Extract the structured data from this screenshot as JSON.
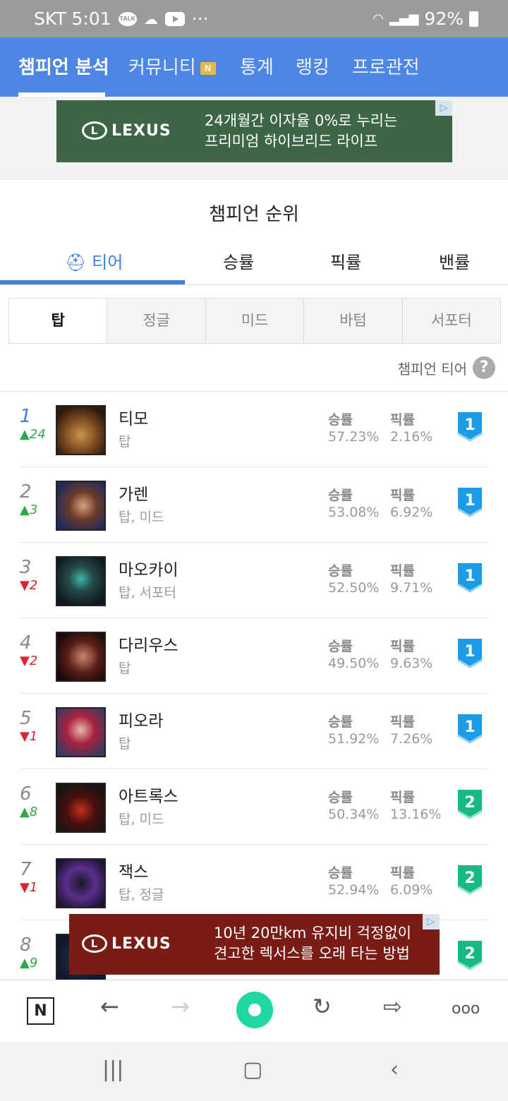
{
  "status_bar": {
    "carrier_time": "SKT 5:01",
    "talk_icon": "TALK",
    "more": "···",
    "battery": "92%"
  },
  "top_nav": {
    "tabs": [
      "챔피언 분석",
      "커뮤니티",
      "통계",
      "랭킹",
      "프로관전"
    ],
    "new_badge": "N"
  },
  "ad_top": {
    "brand": "LEXUS",
    "line1": "24개월간 이자율 0%로 누리는",
    "line2": "프리미엄 하이브리드 라이프"
  },
  "section": {
    "title": "챔피언 순위"
  },
  "rank_tabs": [
    "티어",
    "승률",
    "픽률",
    "밴률"
  ],
  "lanes": [
    "탑",
    "정글",
    "미드",
    "바텀",
    "서포터"
  ],
  "tier_label": "챔피언 티어",
  "help": "?",
  "labels": {
    "winrate": "승률",
    "pickrate": "픽률"
  },
  "champions": [
    {
      "rank": "1",
      "change": "▲24",
      "name": "티모",
      "positions": "탑",
      "winrate": "57.23%",
      "pickrate": "2.16%",
      "tier": "1"
    },
    {
      "rank": "2",
      "change": "▲3",
      "name": "가렌",
      "positions": "탑, 미드",
      "winrate": "53.08%",
      "pickrate": "6.92%",
      "tier": "1"
    },
    {
      "rank": "3",
      "change": "▼2",
      "name": "마오카이",
      "positions": "탑, 서포터",
      "winrate": "52.50%",
      "pickrate": "9.71%",
      "tier": "1"
    },
    {
      "rank": "4",
      "change": "▼2",
      "name": "다리우스",
      "positions": "탑",
      "winrate": "49.50%",
      "pickrate": "9.63%",
      "tier": "1"
    },
    {
      "rank": "5",
      "change": "▼1",
      "name": "피오라",
      "positions": "탑",
      "winrate": "51.92%",
      "pickrate": "7.26%",
      "tier": "1"
    },
    {
      "rank": "6",
      "change": "▲8",
      "name": "아트록스",
      "positions": "탑, 미드",
      "winrate": "50.34%",
      "pickrate": "13.16%",
      "tier": "2"
    },
    {
      "rank": "7",
      "change": "▼1",
      "name": "잭스",
      "positions": "탑, 정글",
      "winrate": "52.94%",
      "pickrate": "6.09%",
      "tier": "2"
    },
    {
      "rank": "8",
      "change": "▲9",
      "tier": "2"
    }
  ],
  "ad_bottom": {
    "brand": "LEXUS",
    "line1": "10년 20만km 유지비 걱정없이",
    "line2": "견고한 렉서스를 오래 타는 방법"
  },
  "browser_bar": {
    "home": "N",
    "back": "←",
    "forward": "→",
    "reload": "↻",
    "share": "⇨",
    "menu": "ooo"
  },
  "system_nav": {
    "recents": "|||",
    "home": "▢",
    "back": "‹"
  },
  "colors": {
    "accent": "#4d86e4",
    "tier1": "#1c9be6",
    "tier2": "#17b884",
    "up": "#2ea84a",
    "down": "#d7262f"
  }
}
